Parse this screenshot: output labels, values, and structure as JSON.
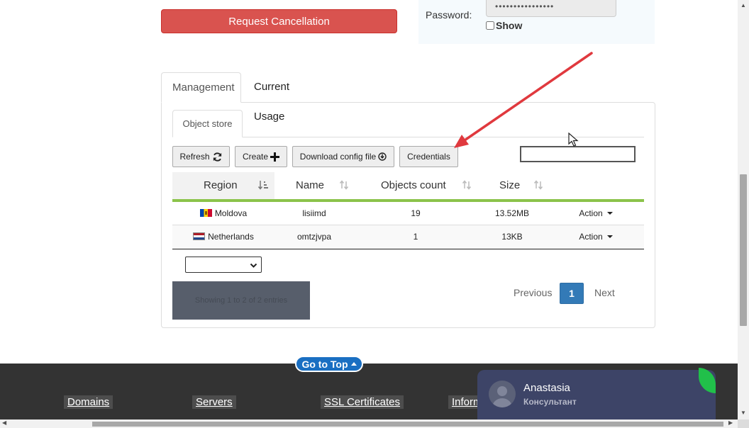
{
  "top": {
    "cancel_label": "Request Cancellation",
    "password_label": "Password:",
    "password_value": "••••••••••••••••",
    "show_label": "Show"
  },
  "tabs": [
    {
      "label": "Management",
      "active": true
    },
    {
      "label": "Current Usage",
      "active": false
    }
  ],
  "subtab": {
    "label": "Object store"
  },
  "toolbar": {
    "refresh_label": "Refresh",
    "create_label": "Create",
    "download_label": "Download config file",
    "credentials_label": "Credentials",
    "search_value": ""
  },
  "table": {
    "columns": [
      "Region",
      "Name",
      "Objects count",
      "Size"
    ],
    "rows": [
      {
        "region": "Moldova",
        "flag": "moldova-flag",
        "name": "lisiimd",
        "objects": "19",
        "size": "13.52MB",
        "action": "Action"
      },
      {
        "region": "Netherlands",
        "flag": "netherlands-flag",
        "name": "omtzjvpa",
        "objects": "1",
        "size": "13KB",
        "action": "Action"
      }
    ],
    "length_select_value": "",
    "info": "Showing 1 to 2 of 2 entries"
  },
  "pagination": {
    "previous": "Previous",
    "current": "1",
    "next": "Next"
  },
  "footer": {
    "go_top": "Go to Top",
    "links": [
      "Domains",
      "Servers",
      "SSL Certificates",
      "Inform"
    ]
  },
  "chat": {
    "name": "Anastasia",
    "role": "Консультант"
  },
  "colors": {
    "danger": "#d9534f",
    "primary": "#337ab7",
    "accent_green": "#8bc34a",
    "annotation_arrow": "#e0393e",
    "footer_bg": "#333333",
    "chat_bg": "#3d4467"
  }
}
